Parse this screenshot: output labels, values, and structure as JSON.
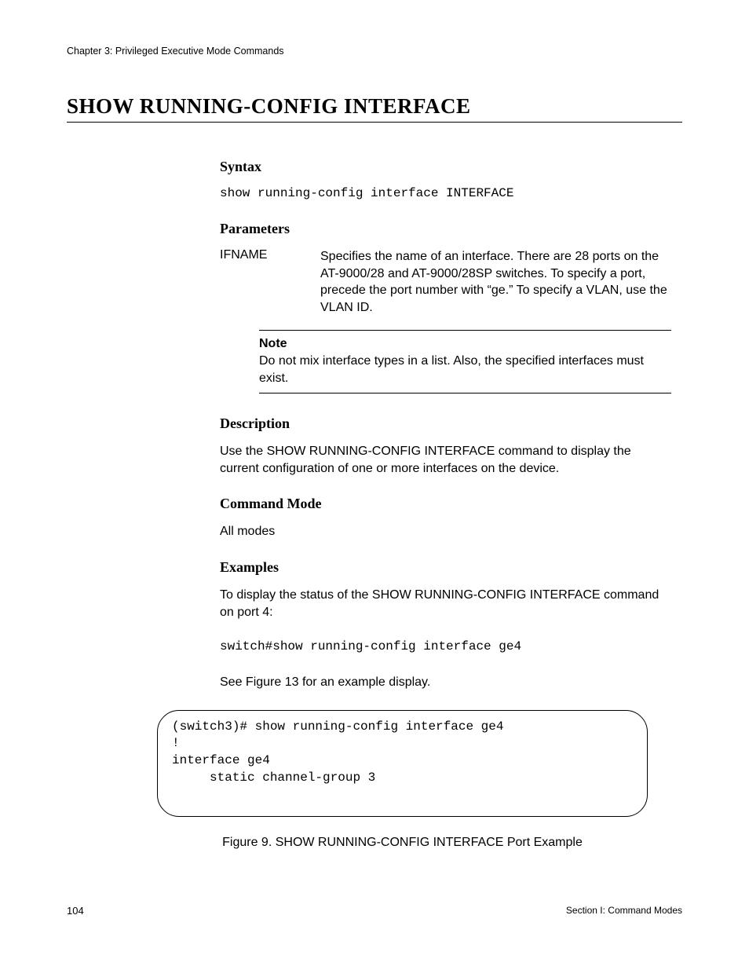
{
  "header": {
    "chapter": "Chapter 3: Privileged Executive Mode Commands"
  },
  "title": "SHOW RUNNING-CONFIG INTERFACE",
  "syntax": {
    "heading": "Syntax",
    "line": "show running-config interface INTERFACE"
  },
  "parameters": {
    "heading": "Parameters",
    "items": [
      {
        "name": "IFNAME",
        "desc": "Specifies the name of an interface. There are 28 ports on the AT-9000/28 and AT-9000/28SP switches. To specify a port, precede the port number with “ge.” To specify a VLAN, use the VLAN ID."
      }
    ],
    "note": {
      "label": "Note",
      "text": "Do not mix interface types in a list. Also, the specified interfaces must exist."
    }
  },
  "description": {
    "heading": "Description",
    "text": "Use the SHOW RUNNING-CONFIG INTERFACE command to display the current configuration of one or more interfaces on the device."
  },
  "command_mode": {
    "heading": "Command Mode",
    "text": "All modes"
  },
  "examples": {
    "heading": "Examples",
    "intro": "To display the status of the SHOW RUNNING-CONFIG INTERFACE command on port 4:",
    "cmd": "switch#show running-config interface ge4",
    "see": "See Figure 13 for an example display.",
    "output": "(switch3)# show running-config interface ge4\n!\ninterface ge4\n     static channel-group 3",
    "caption": "Figure 9. SHOW RUNNING-CONFIG INTERFACE Port Example"
  },
  "footer": {
    "page": "104",
    "section": "Section I: Command Modes"
  }
}
